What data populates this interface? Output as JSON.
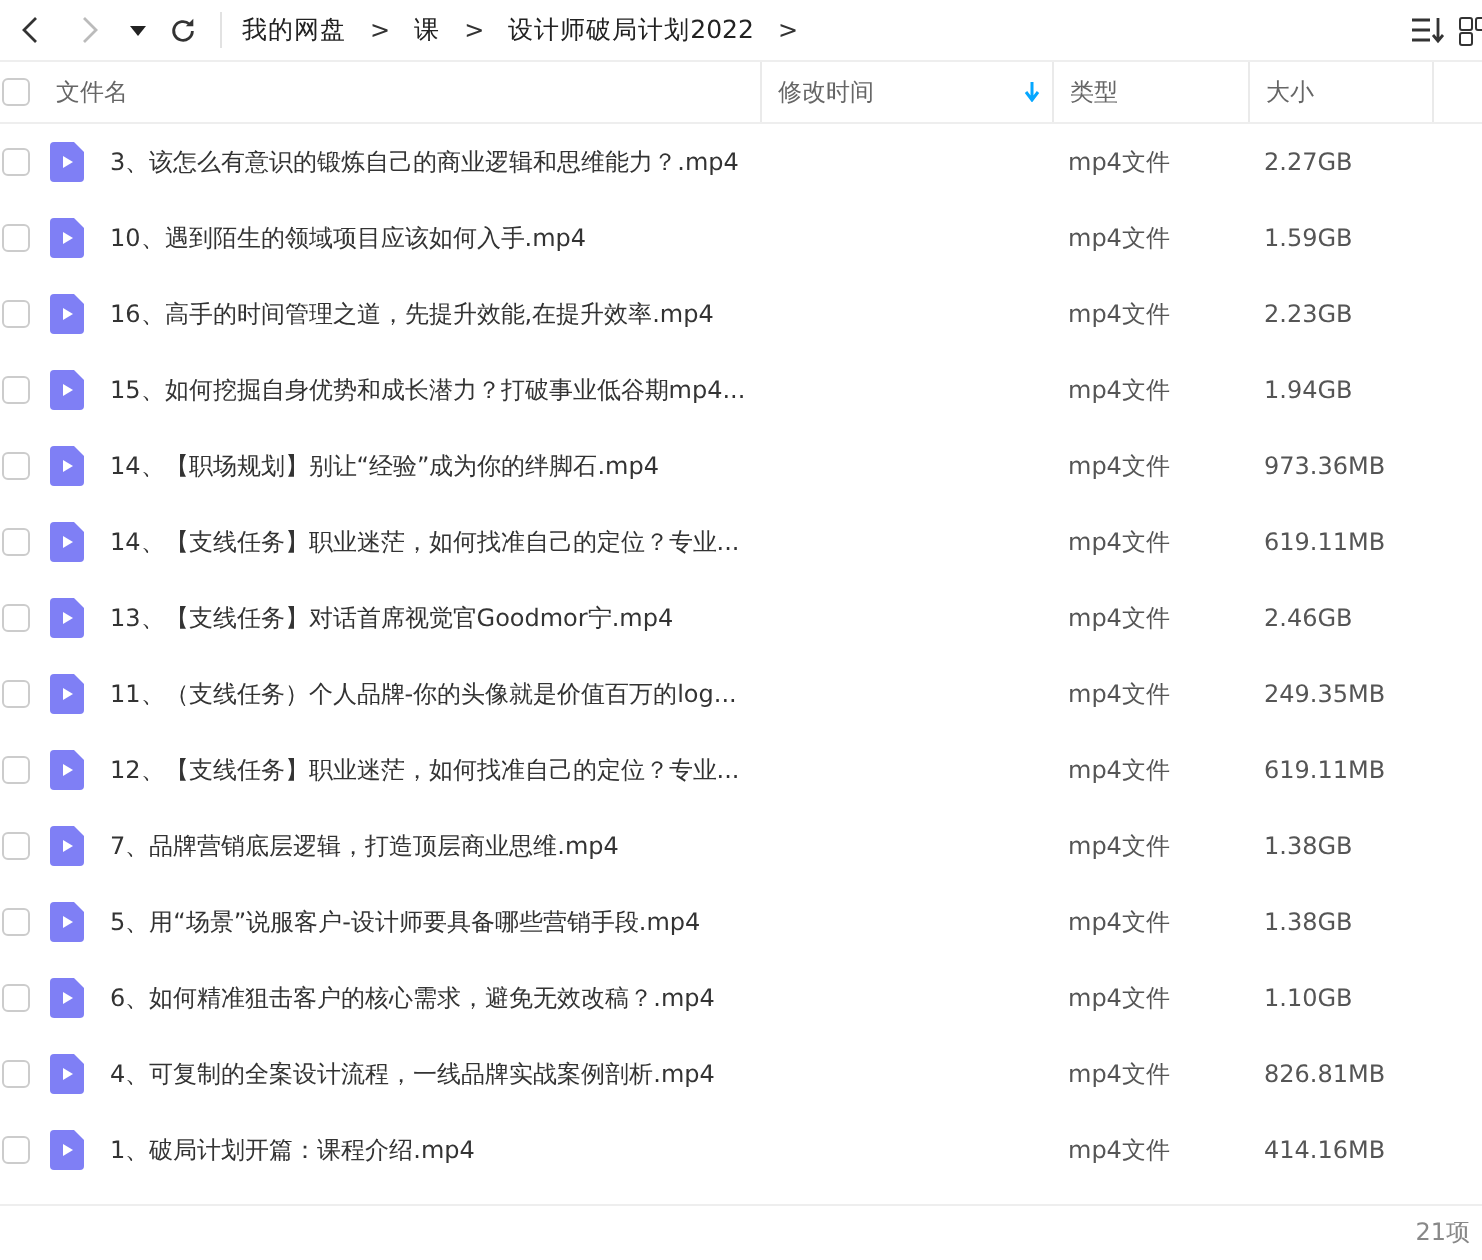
{
  "breadcrumb": [
    {
      "label": "我的网盘",
      "separator": ">"
    },
    {
      "label": "课",
      "separator": ">"
    },
    {
      "label": "设计师破局计划2022",
      "separator": ">"
    }
  ],
  "table": {
    "select_all_checked": false,
    "columns": [
      {
        "label": "文件名",
        "sorted": false
      },
      {
        "label": "修改时间",
        "sorted": true
      },
      {
        "label": "类型",
        "sorted": false
      },
      {
        "label": "大小",
        "sorted": false
      }
    ],
    "rows": [
      {
        "name": "3、该怎么有意识的锻炼自己的商业逻辑和思维能力？.mp4",
        "type": "mp4文件",
        "size": "2.27GB",
        "checked": false
      },
      {
        "name": "10、遇到陌生的领域项目应该如何入手.mp4",
        "type": "mp4文件",
        "size": "1.59GB",
        "checked": false
      },
      {
        "name": "16、高手的时间管理之道，先提升效能,在提升效率.mp4",
        "type": "mp4文件",
        "size": "2.23GB",
        "checked": false
      },
      {
        "name": "15、如何挖掘自身优势和成长潜力？打破事业低谷期mp4...",
        "type": "mp4文件",
        "size": "1.94GB",
        "checked": false
      },
      {
        "name": "14、【职场规划】别让“经验”成为你的绊脚石.mp4",
        "type": "mp4文件",
        "size": "973.36MB",
        "checked": false
      },
      {
        "name": "14、【支线任务】职业迷茫，如何找准自己的定位？专业...",
        "type": "mp4文件",
        "size": "619.11MB",
        "checked": false
      },
      {
        "name": "13、【支线任务】对话首席视觉官Goodmor宁.mp4",
        "type": "mp4文件",
        "size": "2.46GB",
        "checked": false
      },
      {
        "name": "11、（支线任务）个人品牌-你的头像就是价值百万的log...",
        "type": "mp4文件",
        "size": "249.35MB",
        "checked": false
      },
      {
        "name": "12、【支线任务】职业迷茫，如何找准自己的定位？专业...",
        "type": "mp4文件",
        "size": "619.11MB",
        "checked": false
      },
      {
        "name": "7、品牌营销底层逻辑，打造顶层商业思维.mp4",
        "type": "mp4文件",
        "size": "1.38GB",
        "checked": false
      },
      {
        "name": "5、用“场景”说服客户-设计师要具备哪些营销手段.mp4",
        "type": "mp4文件",
        "size": "1.38GB",
        "checked": false
      },
      {
        "name": "6、如何精准狙击客户的核心需求，避免无效改稿？.mp4",
        "type": "mp4文件",
        "size": "1.10GB",
        "checked": false
      },
      {
        "name": "4、可复制的全案设计流程，一线品牌实战案例剖析.mp4",
        "type": "mp4文件",
        "size": "826.81MB",
        "checked": false
      },
      {
        "name": "1、破局计划开篇：课程介绍.mp4",
        "type": "mp4文件",
        "size": "414.16MB",
        "checked": false
      }
    ]
  },
  "status_bar": {
    "count": "21项"
  }
}
